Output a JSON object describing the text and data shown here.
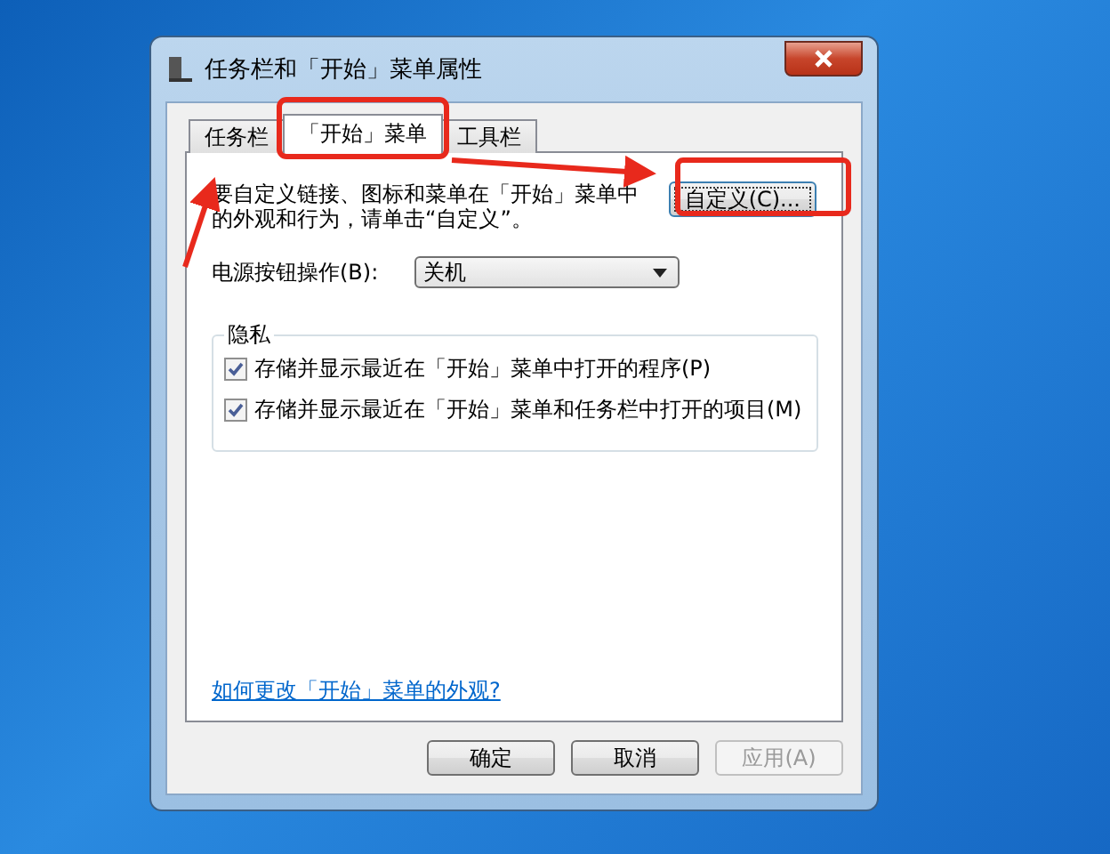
{
  "window": {
    "title": "任务栏和「开始」菜单属性"
  },
  "tabs": [
    {
      "label": "任务栏",
      "selected": false
    },
    {
      "label": "「开始」菜单",
      "selected": true
    },
    {
      "label": "工具栏",
      "selected": false
    }
  ],
  "description": "要自定义链接、图标和菜单在「开始」菜单中的外观和行为，请单击“自定义”。",
  "customize_button": {
    "label": "自定义(C)..."
  },
  "power_button": {
    "label": "电源按钮操作(B):",
    "value": "关机"
  },
  "privacy": {
    "title": "隐私",
    "options": [
      {
        "label": "存储并显示最近在「开始」菜单中打开的程序(P)",
        "checked": true
      },
      {
        "label": "存储并显示最近在「开始」菜单和任务栏中打开的项目(M)",
        "checked": true
      }
    ]
  },
  "help_link": "如何更改「开始」菜单的外观?",
  "buttons": [
    {
      "label": "确定",
      "disabled": false
    },
    {
      "label": "取消",
      "disabled": false
    },
    {
      "label": "应用(A)",
      "disabled": true
    }
  ]
}
